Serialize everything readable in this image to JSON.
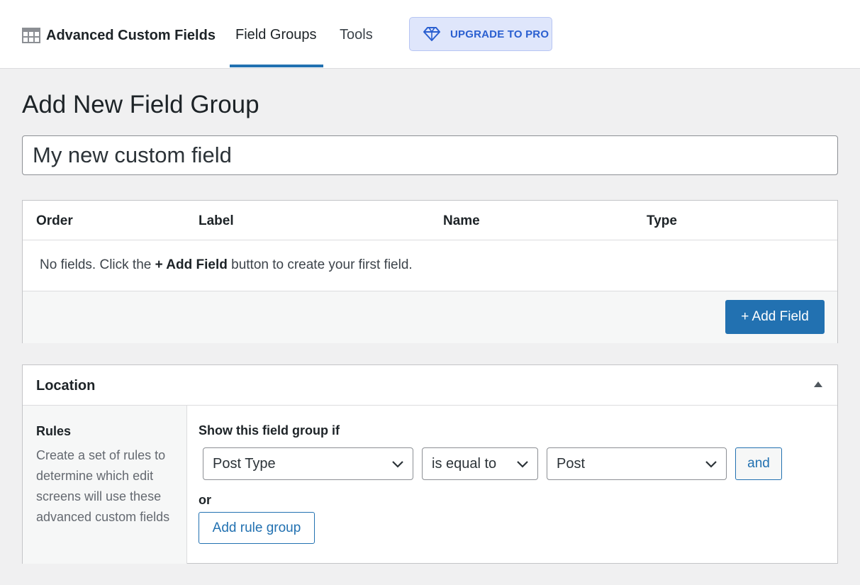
{
  "header": {
    "app_name": "Advanced Custom Fields",
    "app_icon": "table-grid-icon",
    "nav": [
      {
        "label": "Field Groups",
        "active": true
      },
      {
        "label": "Tools",
        "active": false
      }
    ],
    "upgrade_label": "UPGRADE TO PRO",
    "upgrade_icon": "diamond-icon"
  },
  "page_title": "Add New Field Group",
  "title_input": {
    "value": "My new custom field"
  },
  "fields_table": {
    "columns": [
      "Order",
      "Label",
      "Name",
      "Type"
    ],
    "empty_prefix": "No fields. Click the ",
    "empty_bold": "+ Add Field",
    "empty_suffix": " button to create your first field.",
    "add_button": "+ Add Field"
  },
  "location": {
    "title": "Location",
    "rules_title": "Rules",
    "rules_description": "Create a set of rules to determine which edit screens will use these advanced custom fields",
    "show_if_label": "Show this field group if",
    "rule": {
      "param": "Post Type",
      "operator": "is equal to",
      "value": "Post"
    },
    "and_label": "and",
    "or_label": "or",
    "add_rule_group": "Add rule group"
  },
  "colors": {
    "primary": "#2271b1",
    "upgrade_bg": "#dfe6fb",
    "upgrade_text": "#2a5fd0",
    "page_bg": "#f0f0f1"
  }
}
